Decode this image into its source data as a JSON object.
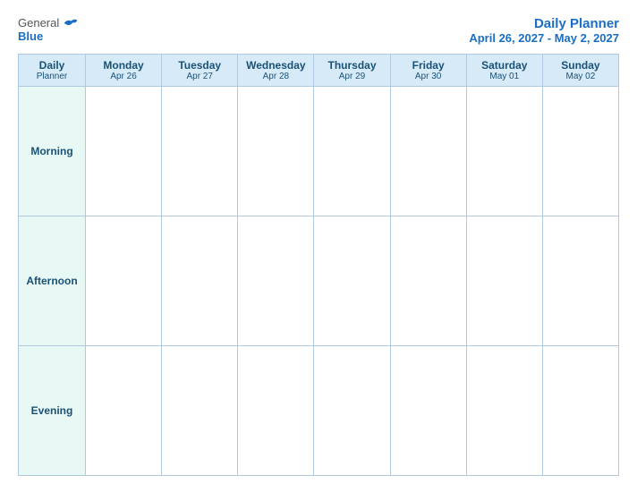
{
  "header": {
    "logo_general": "General",
    "logo_blue": "Blue",
    "title": "Daily Planner",
    "date_range": "April 26, 2027 - May 2, 2027"
  },
  "table": {
    "header_label": "Daily\nPlanner",
    "days": [
      {
        "name": "Monday",
        "date": "Apr 26"
      },
      {
        "name": "Tuesday",
        "date": "Apr 27"
      },
      {
        "name": "Wednesday",
        "date": "Apr 28"
      },
      {
        "name": "Thursday",
        "date": "Apr 29"
      },
      {
        "name": "Friday",
        "date": "Apr 30"
      },
      {
        "name": "Saturday",
        "date": "May 01"
      },
      {
        "name": "Sunday",
        "date": "May 02"
      }
    ],
    "rows": [
      {
        "label": "Morning"
      },
      {
        "label": "Afternoon"
      },
      {
        "label": "Evening"
      }
    ]
  }
}
